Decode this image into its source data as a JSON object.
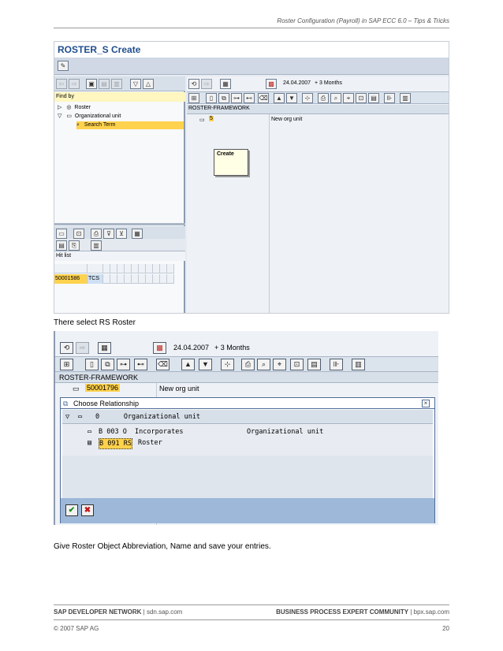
{
  "page": {
    "header": "Roster Configuration (Payroll) in SAP ECC 6.0 – Tips & Tricks",
    "footer_left_bold": "SAP DEVELOPER NETWORK",
    "footer_left_rest": " | sdn.sap.com",
    "footer_right_bold": "BUSINESS PROCESS EXPERT COMMUNITY",
    "footer_right_rest": " | bpx.sap.com",
    "copyright": "© 2007 SAP AG",
    "page_number": "20",
    "text_1": "There select RS Roster",
    "text_2": "Give Roster Object Abbreviation, Name and save your entries."
  },
  "ss1": {
    "title": "ROSTER_S Create",
    "find_by": "Find by",
    "tree": {
      "roster": "Roster",
      "org_unit": "Organizational unit",
      "search_term": "Search Term"
    },
    "hit_list": "Hit list",
    "hit_id": "50001586",
    "hit_code": "TCS",
    "date": "24.04.2007",
    "period": "+ 3 Months",
    "col_header": "ROSTER-FRAMEWORK",
    "row_id_partial": "5",
    "row_name": "New org unit",
    "tooltip": "Create"
  },
  "ss2": {
    "date": "24.04.2007",
    "period": "+ 3 Months",
    "col_header": "ROSTER-FRAMEWORK",
    "row_id": "50001796",
    "row_name": "New org unit",
    "dialog_title": "Choose Relationship",
    "row_0": "0      Organizational unit",
    "row_1_left": "B 003 O  Incorporates",
    "row_1_right": "Organizational unit",
    "row_2_code": "B 091 RS",
    "row_2_name": "Roster"
  },
  "colors": {
    "title_blue": "#1f4e8c",
    "highlight": "#ffd24d",
    "toolbar": "#cfd8e4",
    "dialog_footer": "#9db8d9"
  }
}
